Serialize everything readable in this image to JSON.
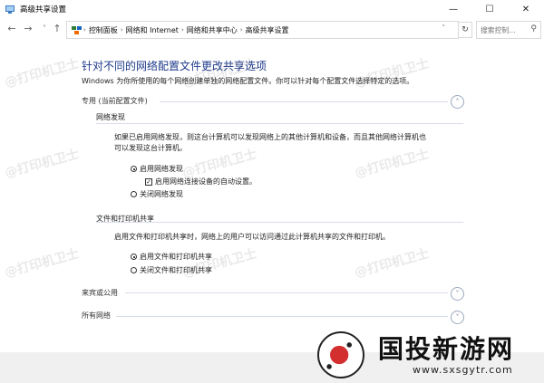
{
  "window": {
    "title": "高级共享设置",
    "controls": {
      "minimize": "—",
      "maximize": "☐",
      "close": "✕"
    }
  },
  "address": {
    "breadcrumbs": [
      "控制面板",
      "网络和 Internet",
      "网络和共享中心",
      "高级共享设置"
    ],
    "search_placeholder": "搜索控制...",
    "refresh_glyph": "↻",
    "dropdown_glyph": "˅"
  },
  "nav": {
    "back": "←",
    "forward": "→",
    "recent": "˅",
    "up": "↑"
  },
  "content": {
    "title": "针对不同的网络配置文件更改共享选项",
    "description": "Windows 为你所使用的每个网络创建单独的网络配置文件。你可以针对每个配置文件选择特定的选项。",
    "private_profile": {
      "label": "专用 (当前配置文件)",
      "network_discovery": {
        "heading": "网络发现",
        "paragraph_line1": "如果已启用网络发现，则这台计算机可以发现网络上的其他计算机和设备，而且其他网络计算机也",
        "paragraph_line2": "可以发现这台计算机。",
        "opt_on": "启用网络发现",
        "opt_auto": "启用网络连接设备的自动设置。",
        "opt_off": "关闭网络发现"
      },
      "file_printer_sharing": {
        "heading": "文件和打印机共享",
        "paragraph": "启用文件和打印机共享时，网络上的用户可以访问通过此计算机共享的文件和打印机。",
        "opt_on": "启用文件和打印机共享",
        "opt_off": "关闭文件和打印机共享"
      }
    },
    "guest_public": {
      "label": "来宾或公用"
    },
    "all_networks": {
      "label": "所有网络"
    }
  },
  "watermark_text": "@打印机卫士",
  "logo": {
    "name": "国投新游网",
    "url": "www.sxsgytr.com"
  },
  "colors": {
    "title_blue": "#1e3a8a",
    "line": "#d7dde6"
  }
}
